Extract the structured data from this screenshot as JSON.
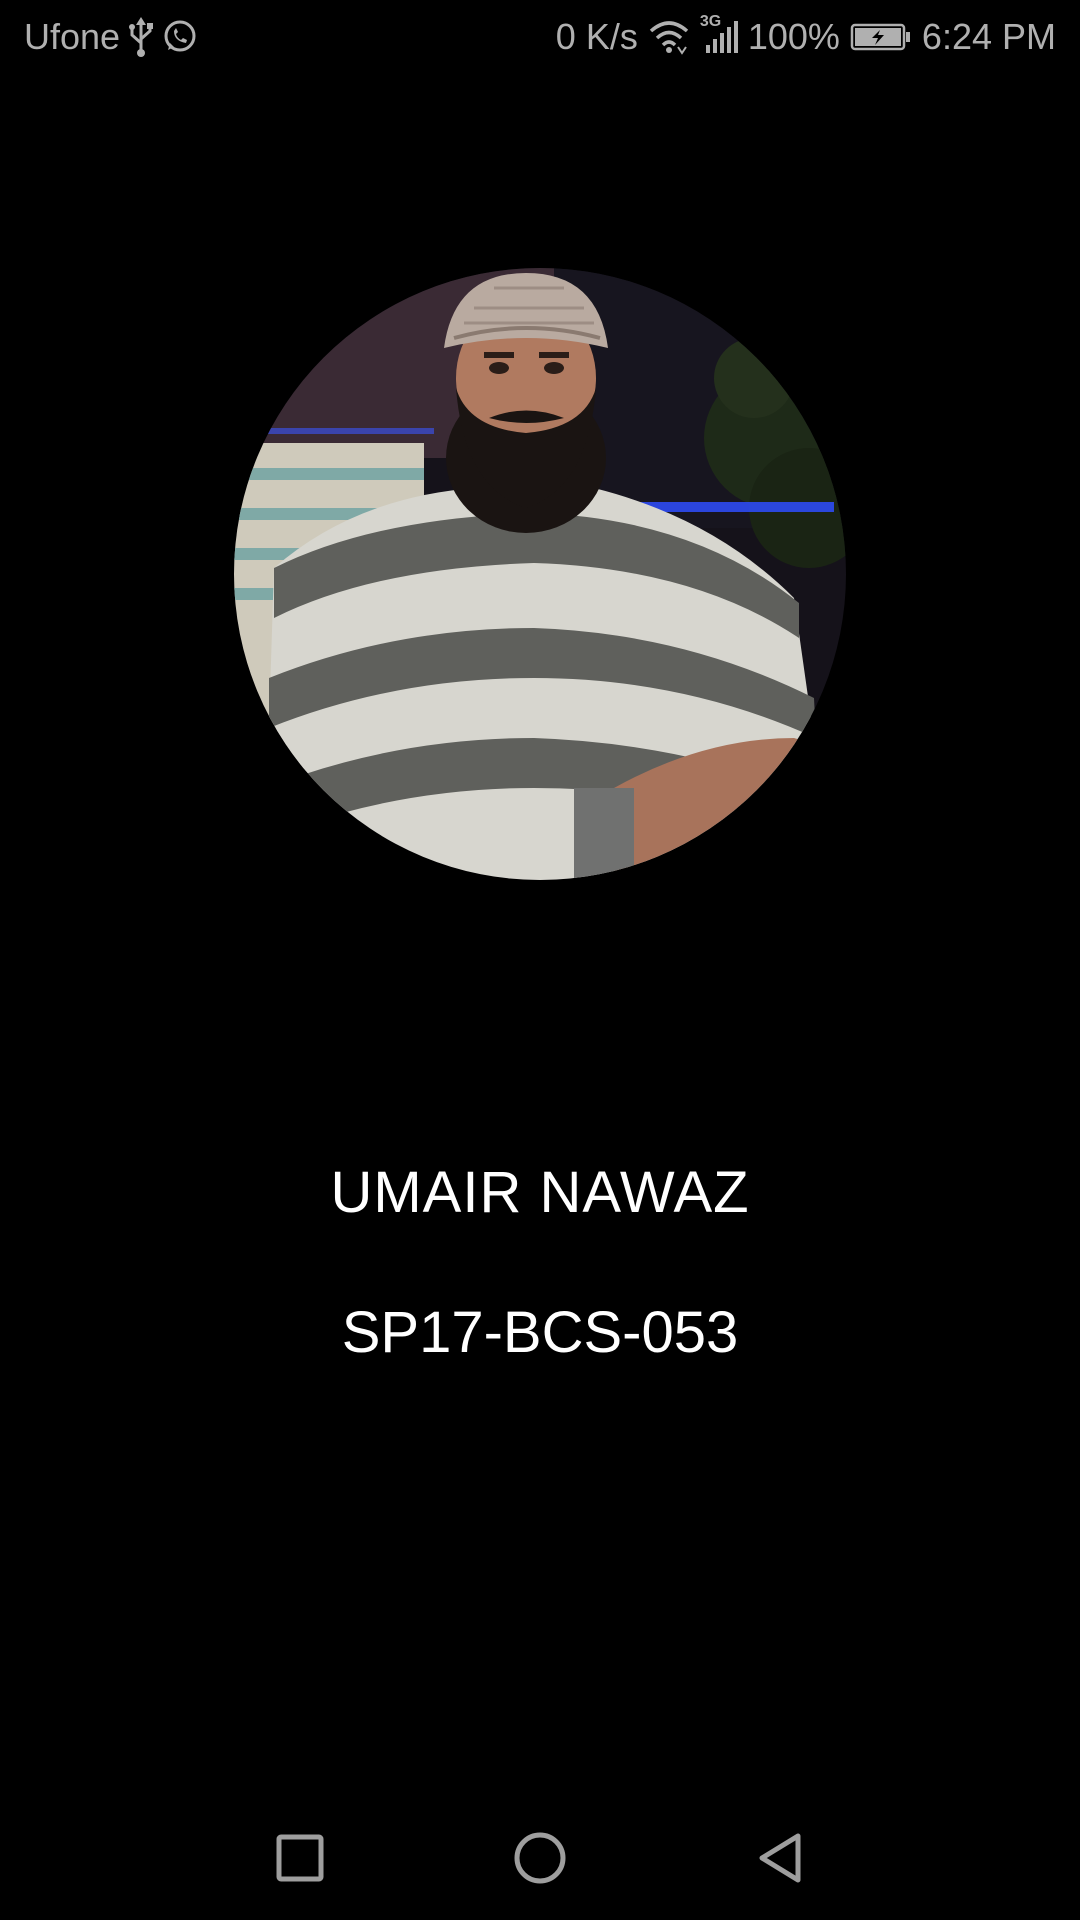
{
  "status_bar": {
    "carrier": "Ufone",
    "network_speed": "0 K/s",
    "network_type": "3G",
    "battery": "100%",
    "time": "6:24 PM",
    "icons": [
      "usb-icon",
      "whatsapp-icon",
      "wifi-icon",
      "signal-icon",
      "battery-charging-icon"
    ]
  },
  "profile": {
    "name": "UMAIR NAWAZ",
    "id": "SP17-BCS-053"
  },
  "nav_bar": {
    "icons": [
      "recent-apps-icon",
      "home-icon",
      "back-icon"
    ]
  },
  "colors": {
    "background": "#000000",
    "text": "#ffffff",
    "status_text": "#b0b0b0",
    "nav_icon": "#9e9e9e"
  }
}
